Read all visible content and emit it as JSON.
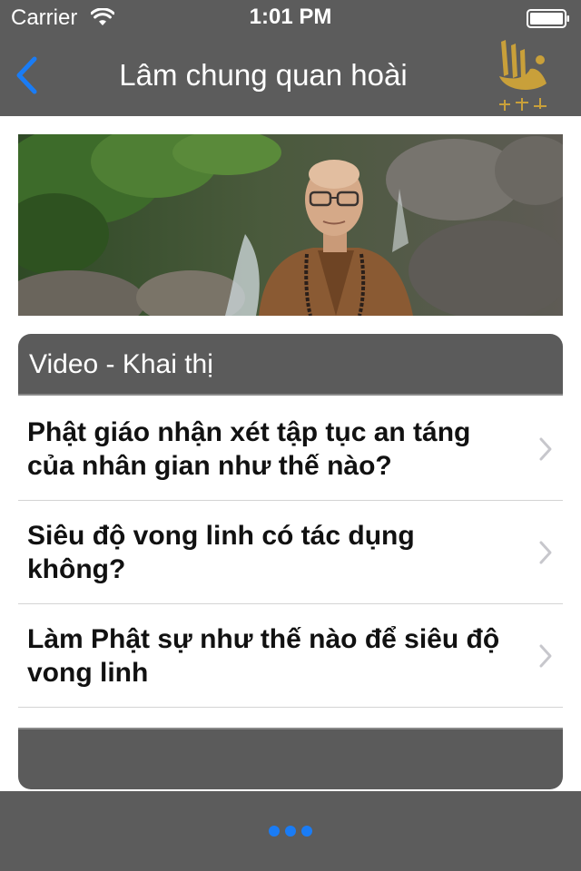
{
  "status_bar": {
    "carrier": "Carrier",
    "time": "1:01 PM"
  },
  "nav": {
    "title": "Lâm chung quan hoài",
    "back_icon": "chevron-left-icon",
    "logo_icon": "dharma-drum-mountain-logo"
  },
  "banner": {
    "description_icon": "monk-portrait-photo"
  },
  "section": {
    "title": "Video - Khai thị",
    "items": [
      {
        "label": "Phật giáo nhận xét tập tục an táng của nhân gian như thế nào?"
      },
      {
        "label": "Siêu độ vong linh có tác dụng không?"
      },
      {
        "label": "Làm Phật sự như thế nào để siêu độ vong linh"
      }
    ]
  },
  "toolbar": {
    "more_icon": "more-dots-icon"
  },
  "colors": {
    "bar_background": "#5c5c5c",
    "accent": "#1a7cf5",
    "logo_gold": "#c9a03a",
    "chevron": "#c7c7cc"
  }
}
